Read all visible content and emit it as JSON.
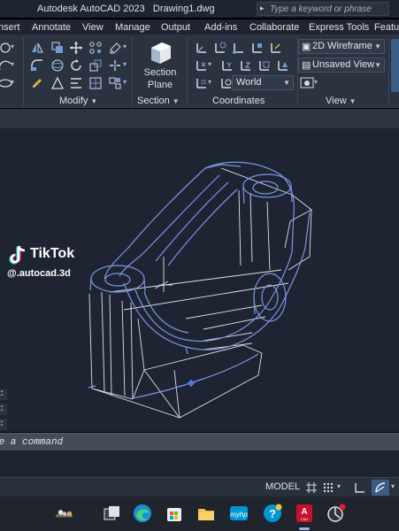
{
  "titlebar": {
    "app_name": "Autodesk AutoCAD 2023",
    "file_name": "Drawing1.dwg",
    "search_placeholder": "Type a keyword or phrase"
  },
  "ribbon_tabs": [
    "nsert",
    "Annotate",
    "View",
    "Manage",
    "Output",
    "Add-ins",
    "Collaborate",
    "Express Tools",
    "Featu"
  ],
  "ribbon": {
    "modify_label": "Modify",
    "section_label": "Section",
    "section_plane": [
      "Section",
      "Plane"
    ],
    "coordinates_label": "Coordinates",
    "ucs_value": "World",
    "view_label": "View",
    "visual_style": "2D Wireframe",
    "saved_view": "Unsaved View"
  },
  "watermark": {
    "name": "TikTok",
    "handle": "@.autocad.3d"
  },
  "command_history": [
    ":",
    ":",
    ":"
  ],
  "command_placeholder": "pe a command",
  "statusbar": {
    "space": "MODEL"
  },
  "icons": {
    "taskbar": [
      "weather-icon",
      "task-view-icon",
      "edge-icon",
      "store-icon",
      "file-explorer-icon",
      "myhp-icon",
      "hp-support-icon",
      "autocad-icon",
      "screen-recorder-icon"
    ],
    "viewport_accent": "#7d95e3",
    "line_color": "#dde2ea",
    "autocad_red": "#c8102e"
  }
}
